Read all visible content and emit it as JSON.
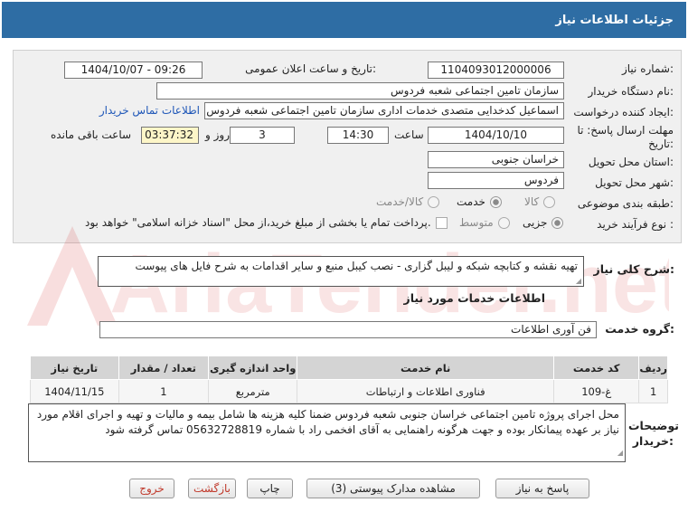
{
  "header": {
    "title": "جزئیات اطلاعات نیاز"
  },
  "form": {
    "need_number": {
      "label": "شماره نیاز:",
      "value": "1104093012000006"
    },
    "announce_datetime": {
      "label": "تاریخ و ساعت اعلان عمومی:",
      "value": "1404/10/07 - 09:26"
    },
    "buyer_org": {
      "label": "نام دستگاه خریدار:",
      "value": "سازمان تامین اجتماعی شعبه فردوس"
    },
    "creator": {
      "label": "ایجاد کننده درخواست:",
      "value": "اسماعیل کدخدایی متصدی خدمات اداری  سازمان تامین اجتماعی شعبه فردوس",
      "contact_link": "اطلاعات تماس خریدار"
    },
    "deadline": {
      "label": "مهلت ارسال پاسخ: تا تاریخ:",
      "date": "1404/10/10",
      "time_label": "ساعت",
      "time": "14:30",
      "days": "3",
      "days_label": "روز و",
      "remaining": "03:37:32",
      "remaining_label": "ساعت باقی مانده"
    },
    "province": {
      "label": "استان محل تحویل:",
      "value": "خراسان جنوبی"
    },
    "city": {
      "label": "شهر محل تحویل:",
      "value": "فردوس"
    },
    "category": {
      "label": "طبقه بندی موضوعی:",
      "options": [
        "کالا",
        "خدمت",
        "کالا/خدمت"
      ],
      "selected": "خدمت"
    },
    "purchase_type": {
      "label": "نوع فرآیند خرید :",
      "options": [
        "جزیی",
        "متوسط"
      ],
      "selected": "جزیی",
      "payment_note": "پرداخت تمام یا بخشی از مبلغ خرید،از محل \"اسناد خزانه اسلامی\" خواهد بود."
    }
  },
  "summary": {
    "label": "شرح کلی نیاز:",
    "value": "تهیه نقشه و کتابچه شبکه و لیبل گزاری - نصب کیبل منبع و سایر اقدامات به شرح فایل های پیوست"
  },
  "services": {
    "title": "اطلاعات خدمات مورد نیاز",
    "group_label": "گروه خدمت:",
    "group_value": "فن آوری اطلاعات",
    "table": {
      "headers": [
        "ردیف",
        "کد خدمت",
        "نام خدمت",
        "واحد اندازه گیری",
        "تعداد / مقدار",
        "تاریخ نیاز"
      ],
      "rows": [
        [
          "1",
          "غ-109",
          "فناوری اطلاعات و ارتباطات",
          "مترمربع",
          "1",
          "1404/11/15"
        ]
      ]
    }
  },
  "buyer_notes": {
    "label": "توضیحات خریدار:",
    "value": "محل اجرای پروژه تامین اجتماعی خراسان جنوبی شعبه فردوس ضمنا کلیه هزینه ها شامل بیمه و مالیات و تهیه و اجرای اقلام مورد نیاز بر عهده پیمانکار بوده و جهت هرگونه راهنمایی به آقای افخمی راد با شماره 05632728819 تماس گرفته شود"
  },
  "buttons": {
    "reply": "پاسخ به نیاز",
    "docs": "مشاهده مدارک پیوستی (3)",
    "print": "چاپ",
    "back": "بازگشت",
    "exit": "خروج"
  },
  "watermark": {
    "text": "AriaTender.net"
  },
  "colors": {
    "header": "#2e6da4",
    "link": "#1f57b8",
    "danger": "#c0392b",
    "highlight": "#fdf6c8"
  }
}
